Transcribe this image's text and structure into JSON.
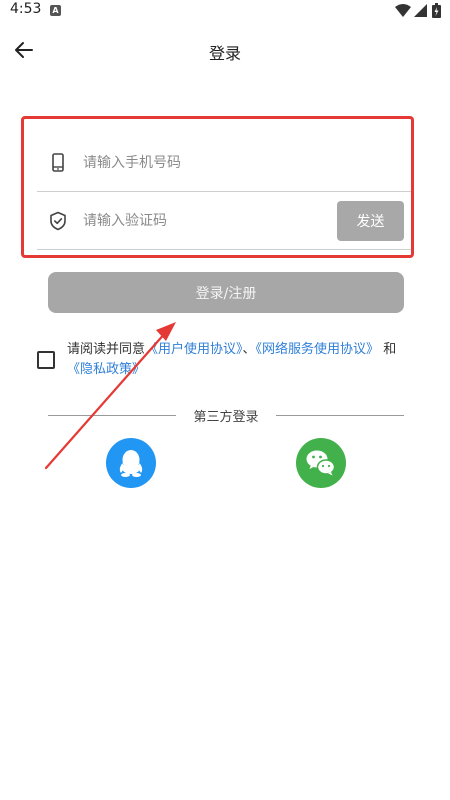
{
  "status_bar": {
    "time": "4:53",
    "notification_letter": "A"
  },
  "header": {
    "title": "登录"
  },
  "form": {
    "phone": {
      "placeholder": "请输入手机号码",
      "value": ""
    },
    "code": {
      "placeholder": "请输入验证码",
      "value": ""
    },
    "send_label": "发送"
  },
  "login_button_label": "登录/注册",
  "agreement": {
    "prefix": "请阅读并同意",
    "user_agreement": "《用户使用协议》",
    "sep1": "、",
    "network_agreement": "《网络服务使用协议》",
    "sep2": " 和 ",
    "privacy_policy": "《隐私政策》",
    "checked": false
  },
  "third_party": {
    "label": "第三方登录",
    "providers": [
      "qq-icon",
      "wechat-icon"
    ]
  },
  "colors": {
    "annotation_red": "#e53935",
    "link_blue": "#2f7fd8",
    "disabled_gray": "#a7a7a7",
    "qq_blue": "#2196f3",
    "wechat_green": "#43b14b"
  }
}
